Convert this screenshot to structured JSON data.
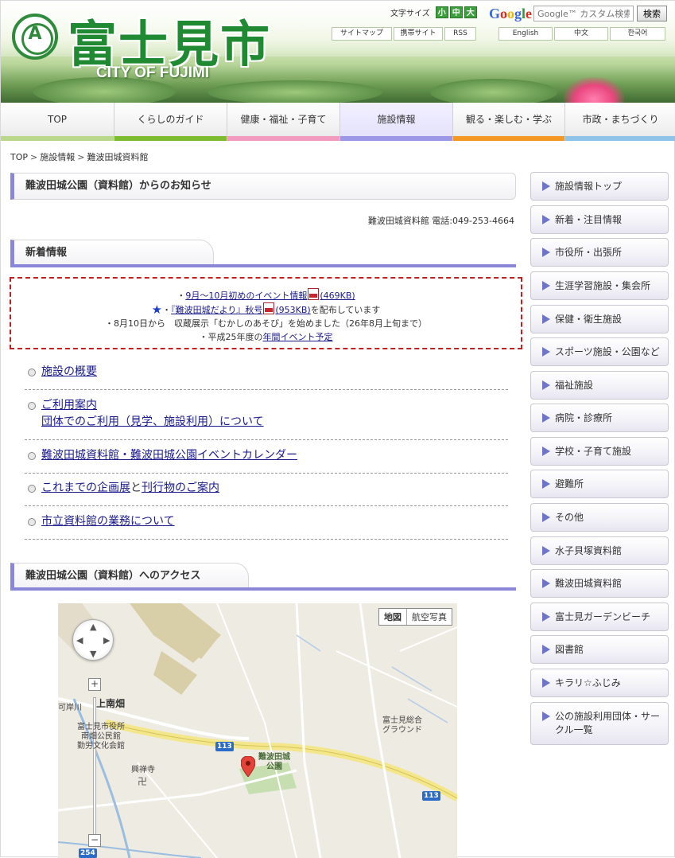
{
  "header": {
    "logo_emblem": "A",
    "logo_title": "富士見市",
    "logo_subtitle": "CITY OF FUJIMI",
    "font_size_label": "文字サイズ",
    "font_sizes": [
      "小",
      "中",
      "大"
    ],
    "google_logo": "Google",
    "search_placeholder": "Google™ カスタム検索",
    "search_button": "検索",
    "links": [
      "サイトマップ",
      "携帯サイト",
      "RSS"
    ],
    "languages": [
      "English",
      "中文",
      "한국어"
    ]
  },
  "nav": {
    "tabs": [
      {
        "label": "TOP",
        "color": "#b9d88c"
      },
      {
        "label": "くらしのガイド",
        "color": "#7dbb2f"
      },
      {
        "label": "健康・福祉・子育て",
        "color": "#f29bbf"
      },
      {
        "label": "施設情報",
        "color": "#9c98e6"
      },
      {
        "label": "観る・楽しむ・学ぶ",
        "color": "#f39822"
      },
      {
        "label": "市政・まちづくり",
        "color": "#8fc3e8"
      }
    ],
    "active_index": 3
  },
  "breadcrumb": [
    "TOP",
    "施設情報",
    "難波田城資料館"
  ],
  "page": {
    "title": "難波田城公園（資料館）からのお知らせ",
    "contact": "難波田城資料館 電話:049-253-4664",
    "news_heading": "新着情報",
    "news": {
      "line1_link": "9月～10月初めのイベント情報",
      "line1_size": "(469KB)",
      "line2_link": "『難波田城だより』秋号",
      "line2_size": "(953KB)",
      "line2_suffix": "を配布しています",
      "line3": "・8月10日から　収蔵展示「むかしのあそび」を始めました（26年8月上旬まで）",
      "line4_prefix": "・平成25年度の",
      "line4_link": "年間イベント予定"
    },
    "links": [
      {
        "lines": [
          "施設の概要"
        ]
      },
      {
        "lines": [
          "ご利用案内",
          "団体でのご利用（見学、施設利用）について"
        ]
      },
      {
        "lines": [
          "難波田城資料館・難波田城公園イベントカレンダー"
        ]
      },
      {
        "part1": "これまでの企画展",
        "part2": "と",
        "part3": "刊行物のご案内"
      },
      {
        "lines": [
          "市立資料館の業務について"
        ]
      }
    ],
    "access_heading": "難波田城公園（資料館）へのアクセス"
  },
  "map": {
    "type_buttons": [
      "地図",
      "航空写真"
    ],
    "zoom_in": "+",
    "zoom_out": "−",
    "labels": {
      "area1": "上南畑",
      "area2": "可岸川",
      "city_hall": "富士見市役所\n南畑公民館\n勤労文化会館",
      "temple": "興禅寺",
      "park": "難波田城\n公園",
      "ground": "富士見総合\nグラウンド"
    },
    "routes": [
      "113",
      "113",
      "254"
    ]
  },
  "sidebar": {
    "items": [
      "施設情報トップ",
      "新着・注目情報",
      "市役所・出張所",
      "生涯学習施設・集会所",
      "保健・衛生施設",
      "スポーツ施設・公園など",
      "福祉施設",
      "病院・診療所",
      "学校・子育て施設",
      "避難所",
      "その他",
      "水子貝塚資料館",
      "難波田城資料館",
      "富士見ガーデンビーチ",
      "図書館",
      "キラリ☆ふじみ",
      "公の施設利用団体・サークル一覧"
    ]
  }
}
